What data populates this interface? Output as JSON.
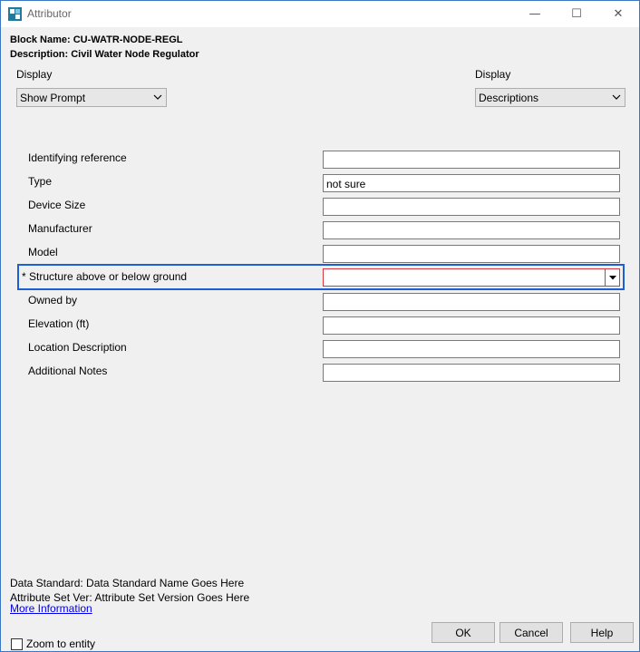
{
  "window": {
    "title": "Attributor",
    "accent_color": "#3a78c4",
    "icon": "attributor-app-icon",
    "controls": {
      "minimize": "—",
      "maximize": "☐",
      "close": "✕"
    }
  },
  "header": {
    "block_name": "Block Name: CU-WATR-NODE-REGL",
    "description": "Description: Civil Water Node Regulator"
  },
  "display_left": {
    "label": "Display",
    "selected": "Show Prompt"
  },
  "display_right": {
    "label": "Display",
    "selected": "Descriptions"
  },
  "fields": [
    {
      "label": "Identifying reference",
      "value": ""
    },
    {
      "label": "Type",
      "value": "not sure"
    },
    {
      "label": "Device Size",
      "value": ""
    },
    {
      "label": "Manufacturer",
      "value": ""
    },
    {
      "label": "Model",
      "value": ""
    },
    {
      "label": "* Structure above or below ground",
      "value": "",
      "required": true
    },
    {
      "label": "Owned by",
      "value": ""
    },
    {
      "label": "Elevation (ft)",
      "value": ""
    },
    {
      "label": "Location Description",
      "value": ""
    },
    {
      "label": "Additional Notes",
      "value": ""
    }
  ],
  "footer": {
    "data_standard": "Data Standard: Data Standard Name Goes Here",
    "attribute_set": "Attribute Set Ver: Attribute Set Version Goes Here",
    "more_info": "More Information"
  },
  "buttons": {
    "ok": "OK",
    "cancel": "Cancel",
    "help": "Help"
  },
  "zoom_to_entity": {
    "label": "Zoom to entity",
    "checked": false
  },
  "colors": {
    "required_border": "#d6373e",
    "focus_frame": "#1e5fd6"
  }
}
